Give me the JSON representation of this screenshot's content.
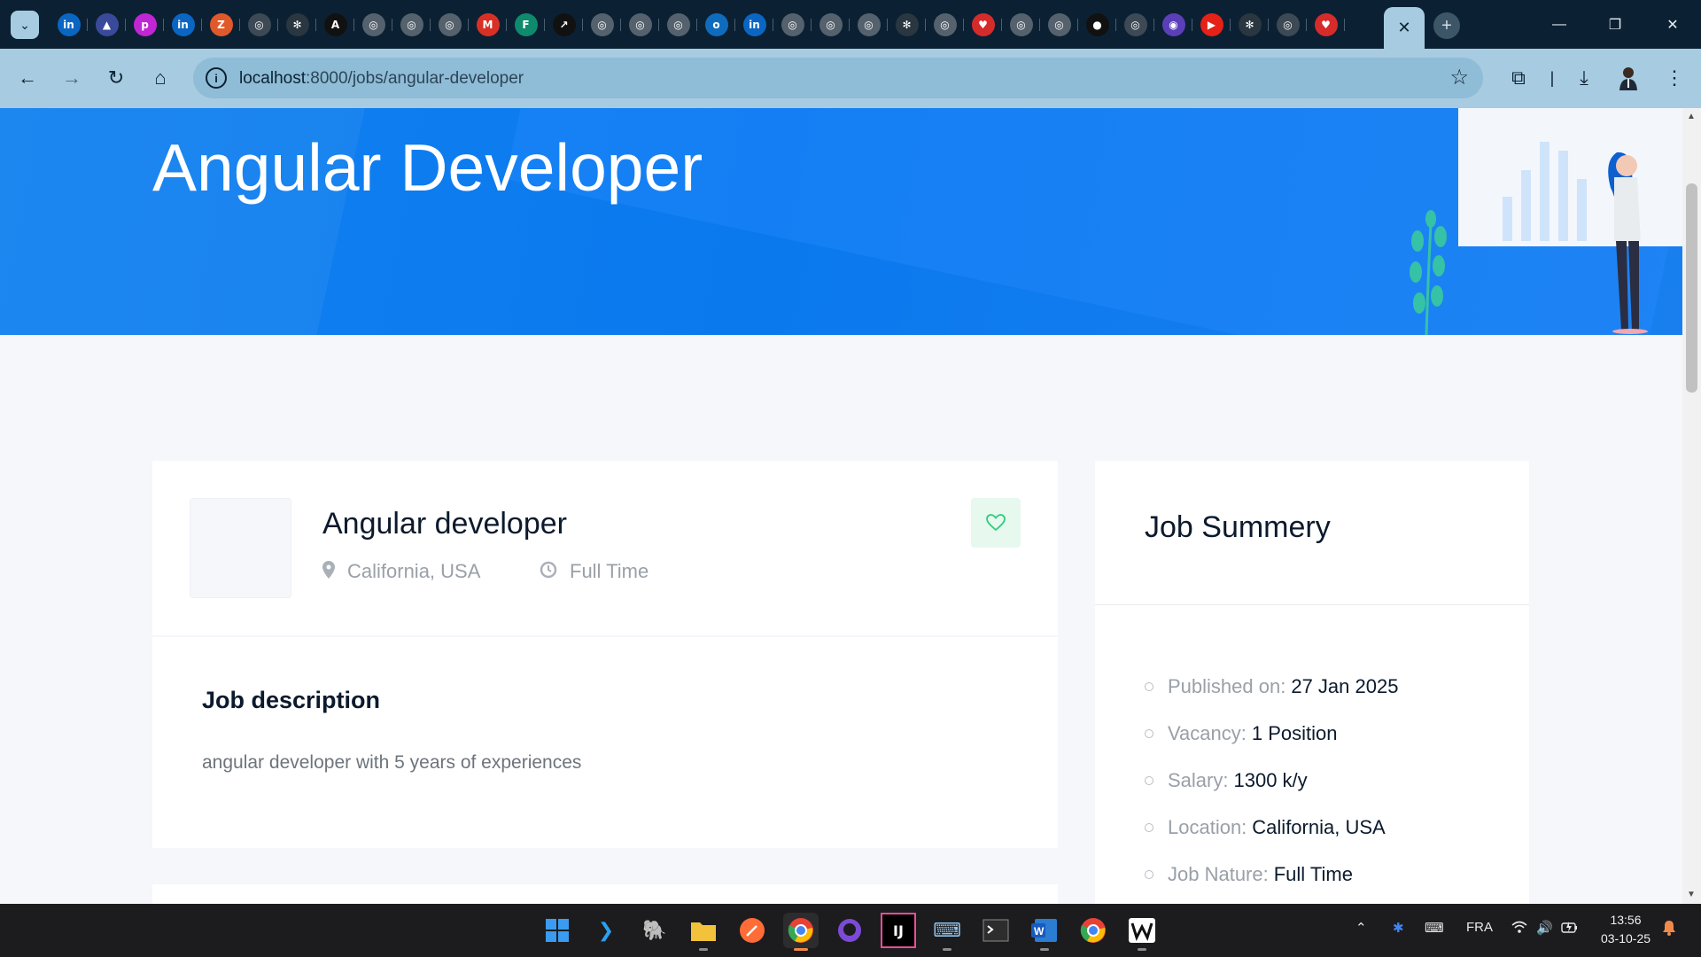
{
  "browser": {
    "tab_icons": [
      {
        "name": "linkedin-tab-icon",
        "glyph": "in",
        "color": "#0a66c2"
      },
      {
        "name": "azure-tab-icon",
        "glyph": "▲",
        "color": "#3a4a9a"
      },
      {
        "name": "picsart-tab-icon",
        "glyph": "p",
        "color": "#c026d3"
      },
      {
        "name": "linkedin-tab-icon",
        "glyph": "in",
        "color": "#0a66c2"
      },
      {
        "name": "zoho-tab-icon",
        "glyph": "Z",
        "color": "#e0592a"
      },
      {
        "name": "globe-tab-icon",
        "glyph": "◎",
        "color": "#3d4a55"
      },
      {
        "name": "chatgpt-tab-icon",
        "glyph": "✻",
        "color": "#2a3640"
      },
      {
        "name": "anthropic-tab-icon",
        "glyph": "A",
        "color": "#111111"
      },
      {
        "name": "globe-tab-icon",
        "glyph": "◎",
        "color": "#55626d"
      },
      {
        "name": "globe-tab-icon",
        "glyph": "◎",
        "color": "#55626d"
      },
      {
        "name": "globe-tab-icon",
        "glyph": "◎",
        "color": "#55626d"
      },
      {
        "name": "gmail-tab-icon",
        "glyph": "M",
        "color": "#d93025"
      },
      {
        "name": "forms-tab-icon",
        "glyph": "F",
        "color": "#0f8a6d"
      },
      {
        "name": "speed-tab-icon",
        "glyph": "↗",
        "color": "#111111"
      },
      {
        "name": "globe-tab-icon",
        "glyph": "◎",
        "color": "#55626d"
      },
      {
        "name": "globe-tab-icon",
        "glyph": "◎",
        "color": "#55626d"
      },
      {
        "name": "globe-tab-icon",
        "glyph": "◎",
        "color": "#55626d"
      },
      {
        "name": "outlook-tab-icon",
        "glyph": "o",
        "color": "#0f6cbd"
      },
      {
        "name": "linkedin-tab-icon",
        "glyph": "in",
        "color": "#0a66c2"
      },
      {
        "name": "globe-tab-icon",
        "glyph": "◎",
        "color": "#55626d"
      },
      {
        "name": "globe-tab-icon",
        "glyph": "◎",
        "color": "#55626d"
      },
      {
        "name": "globe-tab-icon",
        "glyph": "◎",
        "color": "#55626d"
      },
      {
        "name": "chatgpt-tab-icon",
        "glyph": "✻",
        "color": "#2a3640"
      },
      {
        "name": "globe-tab-icon",
        "glyph": "◎",
        "color": "#55626d"
      },
      {
        "name": "heart-tab-icon",
        "glyph": "♥",
        "color": "#d62b2b"
      },
      {
        "name": "globe-tab-icon",
        "glyph": "◎",
        "color": "#55626d"
      },
      {
        "name": "globe-tab-icon",
        "glyph": "◎",
        "color": "#55626d"
      },
      {
        "name": "github-tab-icon",
        "glyph": "●",
        "color": "#111111"
      },
      {
        "name": "chrome-tab-icon",
        "glyph": "◎",
        "color": "#3d4a55"
      },
      {
        "name": "circle-tab-icon",
        "glyph": "◉",
        "color": "#5b3fb8"
      },
      {
        "name": "youtube-tab-icon",
        "glyph": "▶",
        "color": "#e62117"
      },
      {
        "name": "chatgpt-tab-icon",
        "glyph": "✻",
        "color": "#2a3640"
      },
      {
        "name": "chrome-tab-icon",
        "glyph": "◎",
        "color": "#3d4a55"
      },
      {
        "name": "heart-tab-icon",
        "glyph": "♥",
        "color": "#d62b2b"
      }
    ],
    "url_host": "localhost",
    "url_path": ":8000/jobs/angular-developer"
  },
  "hero": {
    "title": "Angular Developer"
  },
  "job": {
    "title": "Angular developer",
    "location": "California, USA",
    "nature": "Full Time",
    "description_title": "Job description",
    "description": "angular developer with 5 years of experiences"
  },
  "summary": {
    "title": "Job Summery",
    "items": [
      {
        "label": "Published on:",
        "value": "27 Jan 2025"
      },
      {
        "label": "Vacancy:",
        "value": "1 Position"
      },
      {
        "label": "Salary:",
        "value": "1300 k/y"
      },
      {
        "label": "Location:",
        "value": "California, USA"
      },
      {
        "label": "Job Nature:",
        "value": "Full Time"
      }
    ]
  },
  "taskbar": {
    "language": "FRA",
    "time": "13:56",
    "date": "03-10-25"
  },
  "colors": {
    "hero_blue": "#0a79ee",
    "accent_green": "#2ccd78",
    "browser_frame": "#0b2133",
    "toolbar": "#a7cbe0"
  }
}
